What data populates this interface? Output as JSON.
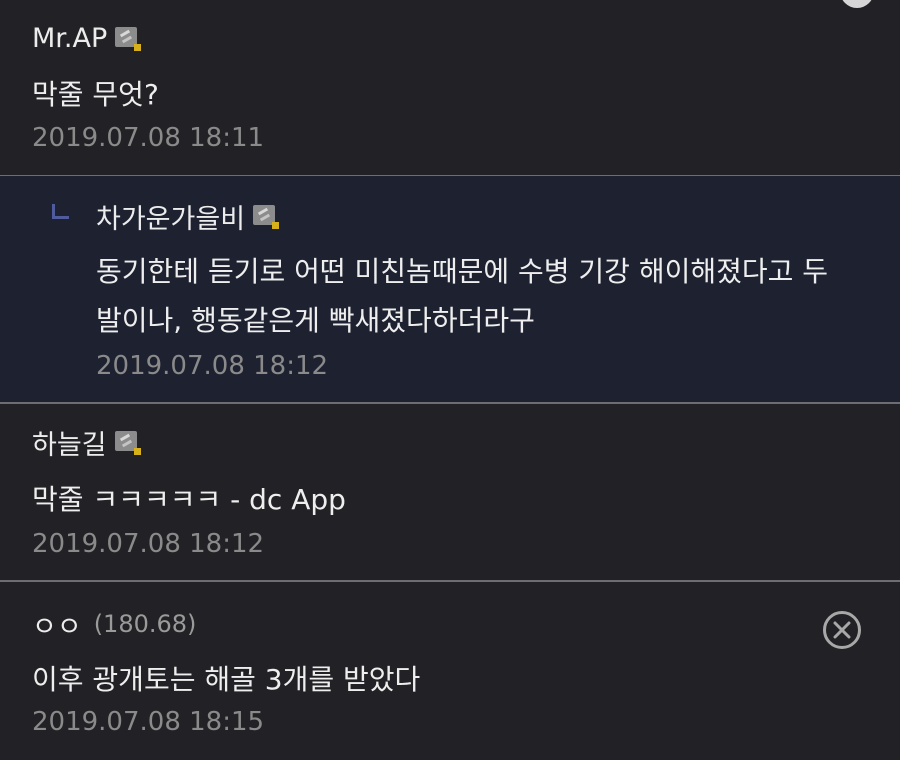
{
  "comments": [
    {
      "nickname": "Mr.AP",
      "badge_icon": "gallery-member-icon",
      "text": "막줄 무엇?",
      "timestamp": "2019.07.08 18:11"
    },
    {
      "is_reply": true,
      "nickname": "차가운가을비",
      "badge_icon": "gallery-member-icon",
      "text_lines": [
        "동기한테 듣기로 어떤 미친놈때문에 수병 기강 해이해졌다고 두",
        "발이나, 행동같은게 빡새졌다하더라구"
      ],
      "timestamp": "2019.07.08 18:12"
    },
    {
      "nickname": "하늘길",
      "badge_icon": "gallery-member-icon",
      "text": "막줄 ㅋㅋㅋㅋㅋ - dc App",
      "timestamp": "2019.07.08 18:12"
    },
    {
      "nickname": "ㅇㅇ",
      "ip": "(180.68)",
      "text": "이후 광개토는 해골 3개를 받았다",
      "timestamp": "2019.07.08 18:15",
      "delete_icon": "close-circle-icon"
    }
  ],
  "colors": {
    "background": "#222226",
    "reply_background": "#1d2130",
    "divider": "#6e6e72",
    "timestamp": "#8a8a8a",
    "reply_marker": "#4f5b9c",
    "badge_dot": "#d8b11a"
  }
}
